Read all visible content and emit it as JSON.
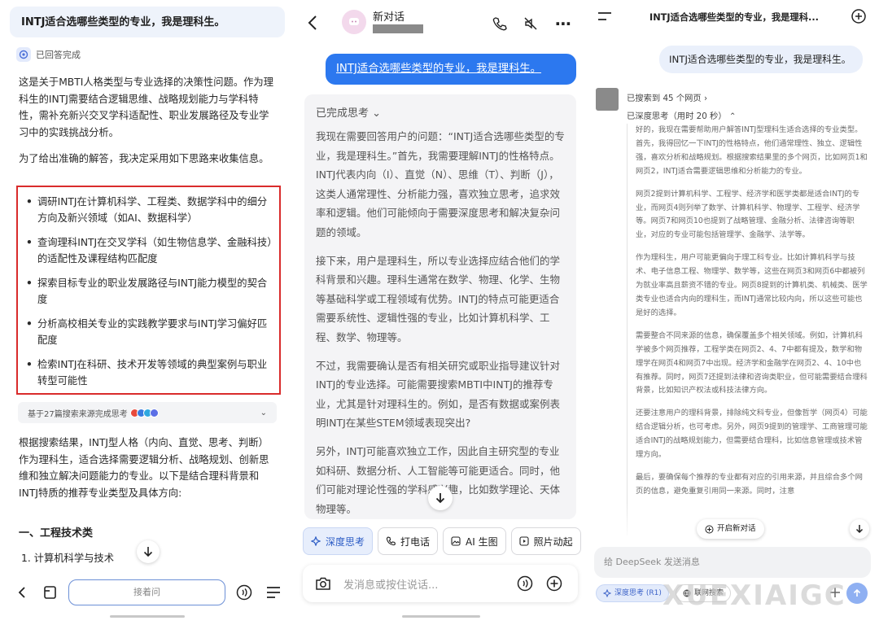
{
  "panel1": {
    "question": "INTJ适合选哪些类型的专业，我是理科生。",
    "status": "已回答完成",
    "intro": "这是关于MBTI人格类型与专业选择的决策性问题。作为理科生的INTJ需要结合逻辑思维、战略规划能力与学科特性，需补充新兴交叉学科适配性、职业发展路径及专业学习中的实践挑战分析。",
    "method": "为了给出准确的解答，我决定采用如下思路来收集信息。",
    "steps": [
      "调研INTJ在计算机科学、工程类、数据学科中的细分方向及新兴领域（如AI、数据科学）",
      "查询理科INTJ在交叉学科（如生物信息学、金融科技）的适配性及课程结构匹配度",
      "探索目标专业的职业发展路径与INTJ能力模型的契合度",
      "分析高校相关专业的实践教学要求与INTJ学习偏好匹配度",
      "检索INTJ在科研、技术开发等领域的典型案例与职业转型可能性"
    ],
    "sources": "基于27篇搜索来源完成思考",
    "answer": "根据搜索结果，INTJ型人格（内向、直觉、思考、判断）作为理科生，适合选择需要逻辑分析、战略规划、创新思维和独立解决问题能力的专业。以下是结合理科背景和INTJ特质的推荐专业类型及具体方向:",
    "heading": "一、工程技术类",
    "subheading": "1. 计算机科学与技术",
    "input_placeholder": "接着问"
  },
  "panel2": {
    "title": "新对话",
    "user_message": "INTJ适合选哪些类型的专业，我是理科生。",
    "thinking_label": "已完成思考",
    "paragraphs": [
      "我现在需要回答用户的问题：“INTJ适合选哪些类型的专业，我是理科生。”首先，我需要理解INTJ的性格特点。INTJ代表内向（I）、直觉（N）、思维（T）、判断（J），这类人通常理性、分析能力强，喜欢独立思考，追求效率和逻辑。他们可能倾向于需要深度思考和解决复杂问题的领域。",
      "接下来，用户是理科生，所以专业选择应结合他们的学科背景和兴趣。理科生通常在数学、物理、化学、生物等基础科学或工程领域有优势。INTJ的特点可能更适合需要系统性、逻辑性强的专业，比如计算机科学、工程、数学、物理等。",
      "不过，我需要确认是否有相关研究或职业指导建议针对INTJ的专业选择。可能需要搜索MBTI中INTJ的推荐专业，尤其是针对理科生的。例如，是否有数据或案例表明INTJ在某些STEM领域表现突出?",
      "另外，INTJ可能喜欢独立工作，因此自主研究型的专业如科研、数据分析、人工智能等可能更适合。同时，他们可能对理论性强的学科感兴趣，比如数学理论、天体物理等。"
    ],
    "tools": [
      {
        "label": "深度思考",
        "icon": "deep-think-icon"
      },
      {
        "label": "打电话",
        "icon": "phone-icon"
      },
      {
        "label": "AI 生图",
        "icon": "image-icon"
      },
      {
        "label": "照片动起",
        "icon": "play-icon"
      }
    ],
    "input_placeholder": "发消息或按住说话..."
  },
  "panel3": {
    "title": "INTJ适合选哪些类型的专业，我是理科...",
    "user_message": "INTJ适合选哪些类型的专业，我是理科生。",
    "searched": "已搜索到 45 个网页",
    "deep_think": "已深度思考（用时 20 秒）",
    "paragraphs": [
      "好的，我现在需要帮助用户解答INTJ型理科生适合选择的专业类型。首先，我得回忆一下INTJ的性格特点，他们通常理性、独立、逻辑性强，喜欢分析和战略规划。根据搜索结果里的多个网页，比如网页1和网页2，INTJ适合需要逻辑思维和分析能力的专业。",
      "网页2提到计算机科学、工程学、经济学和医学类都是适合INTJ的专业，而网页4则列举了数学、计算机科学、物理学、工程学、经济学等。网页7和网页10也提到了战略管理、金融分析、法律咨询等职业，对应的专业可能包括管理学、金融学、法学等。",
      "作为理科生，用户可能更偏向于理工科专业。比如计算机科学与技术、电子信息工程、物理学、数学等，这些在网页3和网页6中都被列为就业率高且薪资不错的专业。网页8提到的计算机类、机械类、医学类专业也适合内向的理科生，而INTJ通常比较内向，所以这些可能也是好的选择。",
      "需要整合不同来源的信息，确保覆盖多个相关领域。例如，计算机科学被多个网页推荐，工程学类在网页2、4、7中都有提及，数学和物理学在网页4和网页7中出现。经济学和金融学在网页2、4、10中也有推荐。同时，网页7还提到法律和咨询类职业，但可能需要结合理科背景，比如知识产权法或科技法律方向。",
      "还要注意用户的理科背景，排除纯文科专业，但像哲学（网页4）可能结合逻辑分析，也可考虑。另外，网页9提到的管理学、工商管理可能适合INTJ的战略规划能力，但需要结合理科，比如信息管理或技术管理方向。",
      "最后，要确保每个推荐的专业都有对应的引用来源，并且综合多个网页的信息，避免重复引用同一来源。同时，注意"
    ],
    "new_chat": "开启新对话",
    "input_placeholder": "给 DeepSeek 发送消息",
    "chip_deep": "深度思考 (R1)",
    "chip_web": "联网搜索"
  },
  "watermark": "XUEXIAIGC",
  "colors": {
    "accent_blue": "#2c78ef",
    "highlight_red": "#d92b2b",
    "deepseek_blue": "#3e64c9"
  }
}
